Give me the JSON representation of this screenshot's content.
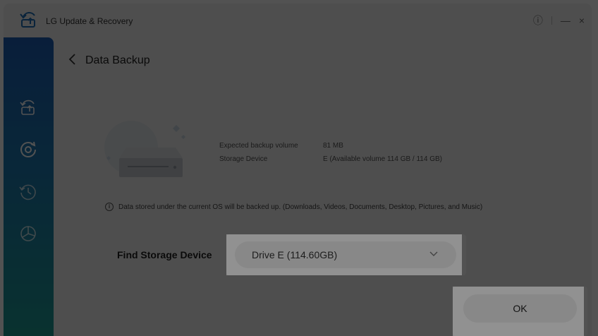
{
  "window": {
    "title": "LG Update & Recovery",
    "controls": {
      "info": "ⓘ",
      "minimize": "—",
      "close": "×"
    }
  },
  "sidebar": {
    "items": [
      {
        "name": "update-icon",
        "selected": false
      },
      {
        "name": "recovery-icon",
        "selected": true
      },
      {
        "name": "history-icon",
        "selected": false
      },
      {
        "name": "driver-icon",
        "selected": false
      }
    ]
  },
  "page": {
    "title": "Data Backup",
    "back_icon": "chevron-left-icon"
  },
  "backup_info": {
    "expected_label": "Expected backup volume",
    "expected_value": "81 MB",
    "device_label": "Storage Device",
    "device_value": "E (Available volume 114 GB / 114 GB)"
  },
  "note": {
    "text": "Data stored under the current OS will be backed up. (Downloads, Videos, Documents, Desktop, Pictures, and Music)"
  },
  "storage": {
    "label": "Find Storage Device",
    "selected": "Drive E (114.60GB)"
  },
  "actions": {
    "ok_label": "OK"
  },
  "colors": {
    "sidebar_top": "#1d5fb4",
    "sidebar_bottom": "#1e9c94",
    "background": "#f3f3f3",
    "overlay": "rgba(0,0,0,0.43)"
  }
}
